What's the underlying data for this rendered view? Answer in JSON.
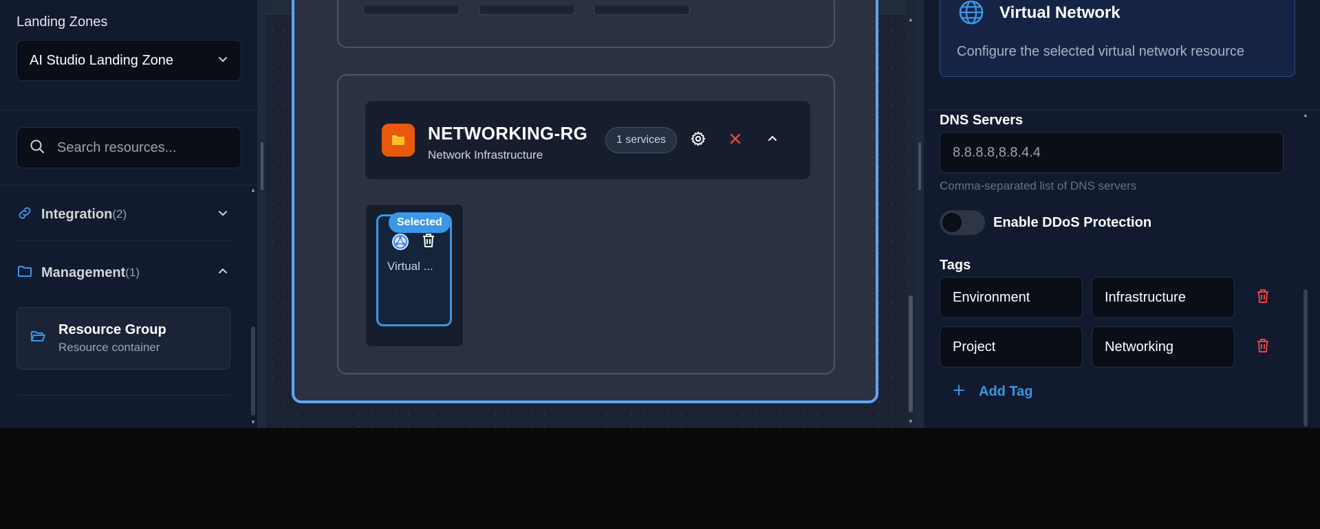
{
  "sidebar": {
    "landing_zones_label": "Landing Zones",
    "landing_zone_selected": "AI Studio Landing Zone",
    "search_placeholder": "Search resources...",
    "sections": [
      {
        "title": "Integration",
        "count": "(2)",
        "expanded": false,
        "icon": "link-icon"
      },
      {
        "title": "Management",
        "count": "(1)",
        "expanded": true,
        "icon": "folder-icon"
      }
    ],
    "resource_item": {
      "title": "Resource Group",
      "subtitle": "Resource container",
      "icon": "folder-open-icon"
    }
  },
  "canvas": {
    "resource_group": {
      "name": "NETWORKING-RG",
      "subtitle": "Network Infrastructure",
      "services_badge": "1 services",
      "icon_color": "#ea580c"
    },
    "service": {
      "label": "Virtual ...",
      "selected_label": "Selected",
      "icon": "network-icon"
    },
    "frame_color": "#60a5fa"
  },
  "panel": {
    "header": {
      "title": "Virtual Network",
      "description": "Configure the selected virtual network resource",
      "icon": "globe-icon"
    },
    "dns": {
      "label": "DNS Servers",
      "value": "8.8.8.8,8.8.4.4",
      "hint": "Comma-separated list of DNS servers"
    },
    "ddos": {
      "label": "Enable DDoS Protection",
      "enabled": false
    },
    "tags": {
      "label": "Tags",
      "items": [
        {
          "key": "Environment",
          "value": "Infrastructure"
        },
        {
          "key": "Project",
          "value": "Networking"
        }
      ],
      "add_label": "Add Tag"
    },
    "accent_color": "#3b97e8",
    "danger_color": "#ef4444"
  }
}
